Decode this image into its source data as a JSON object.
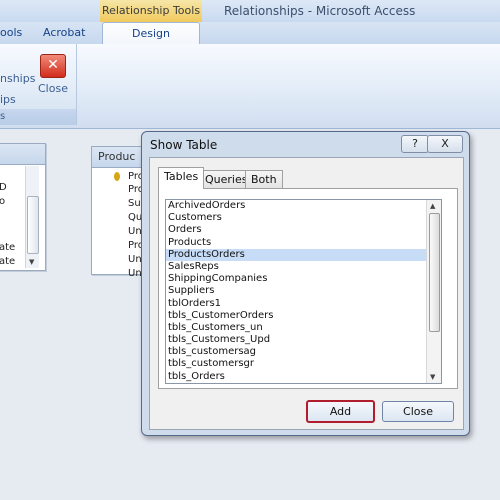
{
  "titlebar": {
    "context_label": "Relationship Tools",
    "app_title": "Relationships - Microsoft Access"
  },
  "tabs": [
    {
      "label": "ools"
    },
    {
      "label": "Acrobat"
    },
    {
      "label": "Design"
    }
  ],
  "ribbon": {
    "partial_item_1": "nships",
    "partial_item_2": "ips",
    "close_label": "Close",
    "group_footer": "s"
  },
  "workspace": {
    "left_table": {
      "fields": [
        "D",
        "o",
        "",
        "ate",
        "ate"
      ]
    },
    "products_table": {
      "title": "Produc",
      "fields": [
        "Pro",
        "Pro",
        "Su",
        "Qu",
        "Uni",
        "Pro",
        "Un",
        "Un"
      ]
    }
  },
  "dialog": {
    "title": "Show Table",
    "help_label": "?",
    "close_label": "X",
    "tabs": [
      {
        "label": "Tables"
      },
      {
        "label": "Queries"
      },
      {
        "label": "Both"
      }
    ],
    "list_items": [
      "ArchivedOrders",
      "Customers",
      "Orders",
      "Products",
      "ProductsOrders",
      "SalesReps",
      "ShippingCompanies",
      "Suppliers",
      "tblOrders1",
      "tbls_CustomerOrders",
      "tbls_Customers_un",
      "tbls_Customers_Upd",
      "tbls_customersag",
      "tbls_customersgr",
      "tbls_Orders"
    ],
    "selected_item": "ProductsOrders",
    "add_label": "Add",
    "close_button_label": "Close"
  },
  "colors": {
    "context_tab": "#f0c95c",
    "selection": "#c6dcf7",
    "add_highlight": "#b11d2c"
  }
}
